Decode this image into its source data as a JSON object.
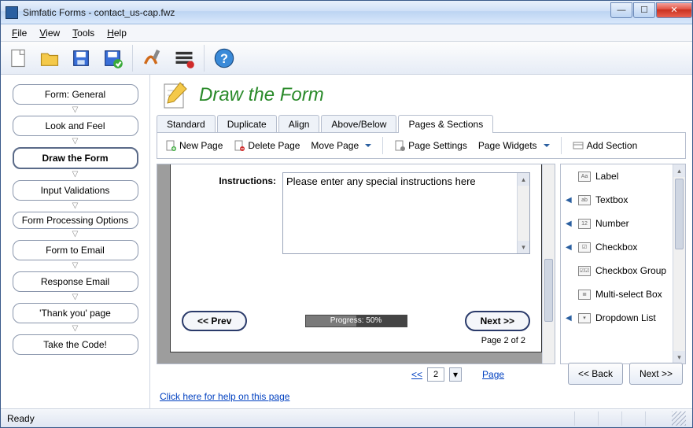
{
  "window": {
    "title": "Simfatic Forms - contact_us-cap.fwz"
  },
  "menu": {
    "file": "File",
    "view": "View",
    "tools": "Tools",
    "help": "Help"
  },
  "sidebar": {
    "items": [
      "Form: General",
      "Look and Feel",
      "Draw the Form",
      "Input Validations",
      "Form Processing Options",
      "Form to Email",
      "Response Email",
      "'Thank you' page",
      "Take the Code!"
    ],
    "active_index": 2
  },
  "heading": "Draw the Form",
  "tabs": {
    "items": [
      "Standard",
      "Duplicate",
      "Align",
      "Above/Below",
      "Pages & Sections"
    ],
    "active_index": 4
  },
  "subtoolbar": {
    "new_page": "New Page",
    "delete_page": "Delete Page",
    "move_page": "Move Page",
    "page_settings": "Page Settings",
    "page_widgets": "Page Widgets",
    "add_section": "Add Section"
  },
  "form": {
    "instructions_label": "Instructions:",
    "instructions_value": "Please enter any special instructions here",
    "prev": "<< Prev",
    "next": "Next >>",
    "progress_text": "Progress: 50%",
    "progress_pct": 50,
    "page_text": "Page 2 of 2"
  },
  "palette": {
    "items": [
      {
        "label": "Label",
        "expandable": false
      },
      {
        "label": "Textbox",
        "expandable": true
      },
      {
        "label": "Number",
        "expandable": true
      },
      {
        "label": "Checkbox",
        "expandable": true
      },
      {
        "label": "Checkbox Group",
        "expandable": false
      },
      {
        "label": "Multi-select Box",
        "expandable": false
      },
      {
        "label": "Dropdown List",
        "expandable": true
      }
    ]
  },
  "pager": {
    "first": "<<",
    "num": "2",
    "page_link": "Page"
  },
  "help_link": "Click here for help on this page",
  "wizard": {
    "back": "<< Back",
    "next": "Next >>"
  },
  "status": "Ready"
}
